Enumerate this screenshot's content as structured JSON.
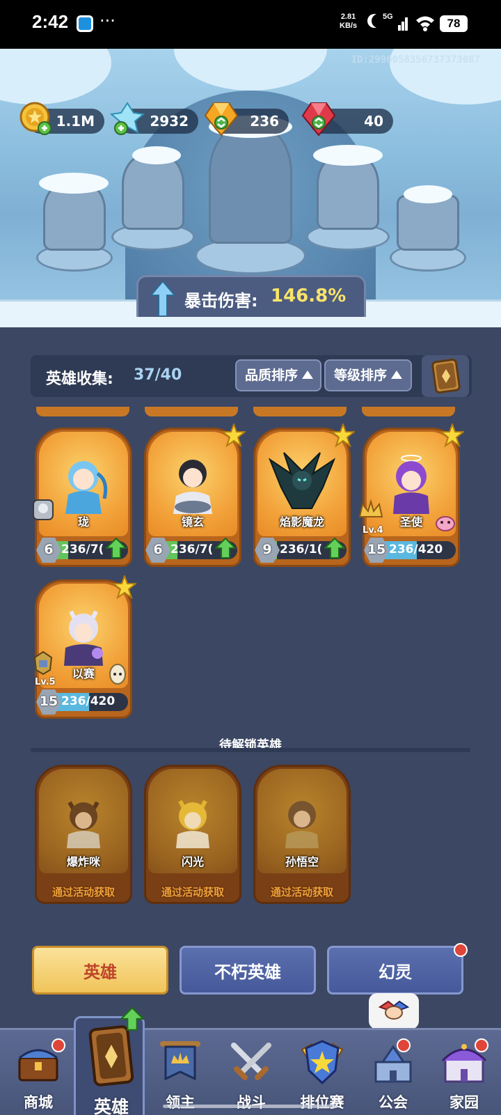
{
  "status_bar": {
    "time": "2:42",
    "more": "···",
    "net_speed_value": "2.81",
    "net_speed_unit": "KB/s",
    "network": "5G",
    "battery": "78"
  },
  "banner": {
    "player_id": "ID:2996058356737373087",
    "resources": [
      {
        "icon": "gold-coin-icon",
        "value": "1.1M"
      },
      {
        "icon": "blue-crystal-icon",
        "value": "2932"
      },
      {
        "icon": "orange-gem-icon",
        "value": "236"
      },
      {
        "icon": "red-gem-icon",
        "value": "40"
      }
    ],
    "crit_label": "暴击伤害:",
    "crit_value": "146.8%"
  },
  "collection": {
    "label": "英雄收集:",
    "count": "37/40",
    "sort_quality": "品质排序",
    "sort_level": "等级排序"
  },
  "heroes": [
    {
      "name": "珑",
      "level": "6",
      "progress": "236/7(",
      "fill": 0.33,
      "fill_color": "green",
      "upgrade": true,
      "star": false
    },
    {
      "name": "镜玄",
      "level": "6",
      "progress": "236/7(",
      "fill": 0.33,
      "fill_color": "green",
      "upgrade": true,
      "star": true
    },
    {
      "name": "焰影魔龙",
      "level": "9",
      "progress": "236/1(",
      "fill": 0.22,
      "fill_color": "green",
      "upgrade": true,
      "star": true
    },
    {
      "name": "圣使",
      "level": "15",
      "progress": "236/420",
      "fill": 0.56,
      "fill_color": "blue",
      "upgrade": false,
      "star": true,
      "badge": "Lv.4"
    },
    {
      "name": "以赛",
      "level": "15",
      "progress": "236/420",
      "fill": 0.56,
      "fill_color": "blue",
      "upgrade": false,
      "star": true,
      "badge": "Lv.5"
    }
  ],
  "locked_section": {
    "title": "待解锁英雄",
    "heroes": [
      {
        "name": "爆炸咪",
        "hint": "通过活动获取"
      },
      {
        "name": "闪光",
        "hint": "通过活动获取"
      },
      {
        "name": "孙悟空",
        "hint": "通过活动获取"
      }
    ]
  },
  "tabs": [
    {
      "label": "英雄",
      "active": true
    },
    {
      "label": "不朽英雄",
      "active": false
    },
    {
      "label": "幻灵",
      "active": false
    }
  ],
  "bottom_nav": [
    {
      "label": "商城",
      "icon": "shop-chest-icon"
    },
    {
      "label": "英雄",
      "icon": "hero-card-icon"
    },
    {
      "label": "领主",
      "icon": "banner-crown-icon"
    },
    {
      "label": "战斗",
      "icon": "crossed-swords-icon"
    },
    {
      "label": "排位赛",
      "icon": "rank-shield-icon"
    },
    {
      "label": "公会",
      "icon": "guild-castle-icon"
    },
    {
      "label": "家园",
      "icon": "home-palace-icon"
    }
  ],
  "colors": {
    "background": "#3b4763",
    "crit_value": "#f8e46a",
    "card_orange": "#e88b26",
    "active_tab": "#f0c45a",
    "locked_hint": "#f2a23a"
  }
}
